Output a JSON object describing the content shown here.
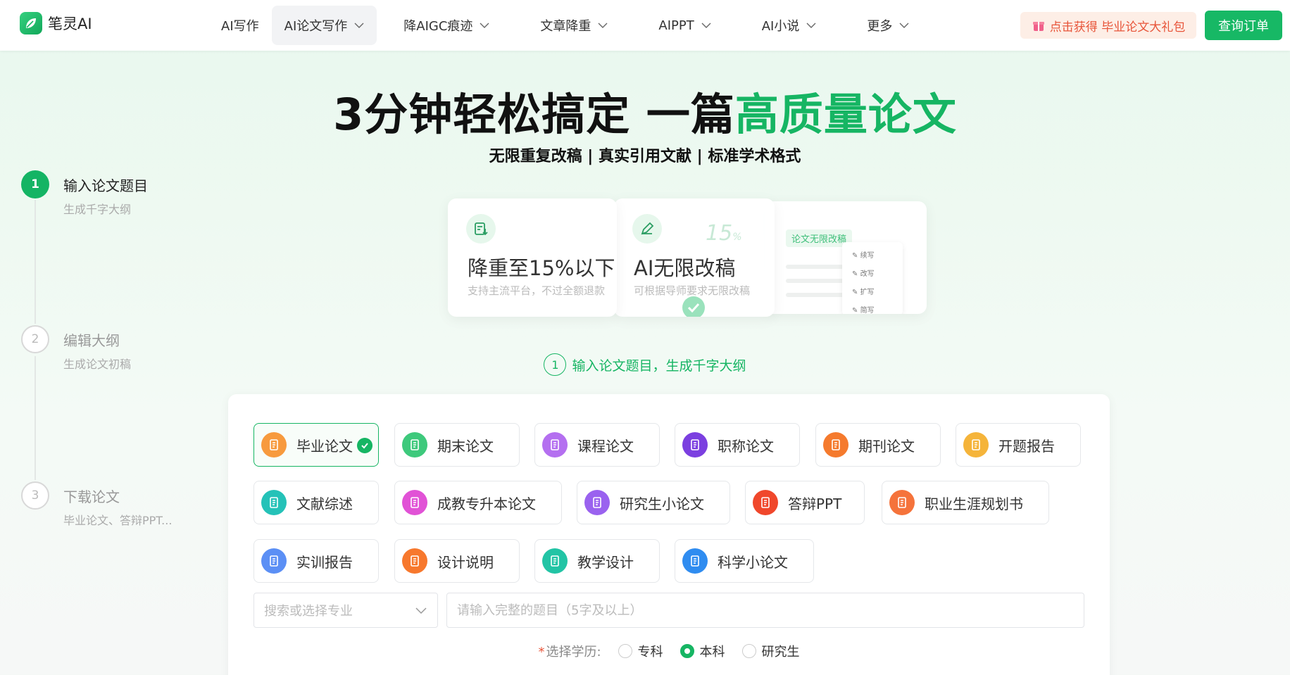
{
  "brand": {
    "name": "笔灵AI"
  },
  "nav": {
    "items": [
      {
        "label": "AI写作",
        "has_dropdown": false,
        "active": false
      },
      {
        "label": "AI论文写作",
        "has_dropdown": true,
        "active": true
      },
      {
        "label": "降AIGC痕迹",
        "has_dropdown": true,
        "active": false
      },
      {
        "label": "文章降重",
        "has_dropdown": true,
        "active": false
      },
      {
        "label": "AIPPT",
        "has_dropdown": true,
        "active": false
      },
      {
        "label": "AI小说",
        "has_dropdown": true,
        "active": false
      },
      {
        "label": "更多",
        "has_dropdown": true,
        "active": false
      }
    ],
    "gift_label": "点击获得 毕业论文大礼包",
    "order_label": "查询订单"
  },
  "hero": {
    "title_black": "3分钟轻松搞定 一篇",
    "title_green": "高质量论文",
    "subtitle": "无限重复改稿 | 真实引用文献 | 标准学术格式"
  },
  "steps": [
    {
      "num": "1",
      "title": "输入论文题目",
      "desc": "生成千字大纲",
      "active": true
    },
    {
      "num": "2",
      "title": "编辑大纲",
      "desc": "生成论文初稿",
      "active": false
    },
    {
      "num": "3",
      "title": "下载论文",
      "desc": "毕业论文、答辩PPT...",
      "active": false
    }
  ],
  "feature_cards": [
    {
      "title": "降重至15%以下",
      "desc": "支持主流平台，不过全额退款"
    },
    {
      "title": "AI无限改稿",
      "desc": "可根据导师要求无限改稿",
      "deco_pct": "15",
      "deco_pct_unit": "%"
    },
    {
      "label": "论文无限改稿",
      "menu": [
        "续写",
        "改写",
        "扩写",
        "简写"
      ]
    }
  ],
  "step_hint": {
    "num": "1",
    "text": "输入论文题目，生成千字大纲"
  },
  "paper_types": [
    {
      "label": "毕业论文",
      "color": "#f79a3e",
      "selected": true
    },
    {
      "label": "期末论文",
      "color": "#3ec97c",
      "selected": false
    },
    {
      "label": "课程论文",
      "color": "#b46ff0",
      "selected": false
    },
    {
      "label": "职称论文",
      "color": "#7b3fe0",
      "selected": false
    },
    {
      "label": "期刊论文",
      "color": "#f57a2d",
      "selected": false
    },
    {
      "label": "开题报告",
      "color": "#f5b43a",
      "selected": false
    },
    {
      "label": "文献综述",
      "color": "#25c2b8",
      "selected": false
    },
    {
      "label": "成教专升本论文",
      "color": "#e152d6",
      "selected": false
    },
    {
      "label": "研究生小论文",
      "color": "#9a62ef",
      "selected": false
    },
    {
      "label": "答辩PPT",
      "color": "#f0472b",
      "selected": false
    },
    {
      "label": "职业生涯规划书",
      "color": "#f5733b",
      "selected": false
    },
    {
      "label": "实训报告",
      "color": "#5b8ff5",
      "selected": false
    },
    {
      "label": "设计说明",
      "color": "#f7782d",
      "selected": false
    },
    {
      "label": "教学设计",
      "color": "#22c4a5",
      "selected": false
    },
    {
      "label": "科学小论文",
      "color": "#2f8cf0",
      "selected": false
    }
  ],
  "form": {
    "major_placeholder": "搜索或选择专业",
    "topic_placeholder": "请输入完整的题目（5字及以上）",
    "topic_value": "",
    "edu_label": "选择学历:",
    "edu_required_mark": "*",
    "edu_options": [
      {
        "label": "专科",
        "checked": false
      },
      {
        "label": "本科",
        "checked": true
      },
      {
        "label": "研究生",
        "checked": false
      }
    ]
  },
  "colors": {
    "accent": "#16b563",
    "gift": "#e8553a"
  }
}
